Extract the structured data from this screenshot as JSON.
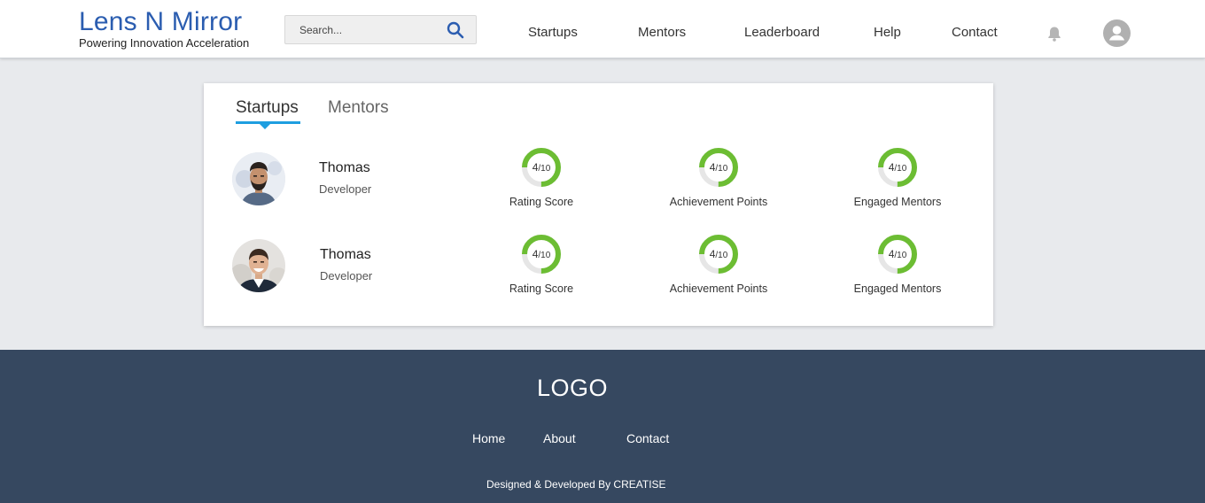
{
  "header": {
    "brand_title": "Lens N Mirror",
    "brand_subtitle": "Powering Innovation Acceleration",
    "search_placeholder": "Search...",
    "nav": [
      "Startups",
      "Mentors",
      "Leaderboard",
      "Help",
      "Contact"
    ]
  },
  "tabs": {
    "active": "Startups",
    "inactive": "Mentors"
  },
  "rows": [
    {
      "name": "Thomas",
      "role": "Developer",
      "metrics": [
        {
          "value": "4",
          "max": "/10",
          "label": "Rating Score",
          "fraction": 0.75
        },
        {
          "value": "4",
          "max": "/10",
          "label": "Achievement Points",
          "fraction": 0.75
        },
        {
          "value": "4",
          "max": "/10",
          "label": "Engaged Mentors",
          "fraction": 0.75
        }
      ]
    },
    {
      "name": "Thomas",
      "role": "Developer",
      "metrics": [
        {
          "value": "4",
          "max": "/10",
          "label": "Rating Score",
          "fraction": 0.75
        },
        {
          "value": "4",
          "max": "/10",
          "label": "Achievement Points",
          "fraction": 0.75
        },
        {
          "value": "4",
          "max": "/10",
          "label": "Engaged Mentors",
          "fraction": 0.75
        }
      ]
    }
  ],
  "footer": {
    "logo": "LOGO",
    "links": [
      "Home",
      "About",
      "Contact"
    ],
    "credit": "Designed & Developed By CREATISE"
  },
  "colors": {
    "brand": "#2b5db0",
    "accent_tab": "#1e9ee0",
    "donut_fill": "#6cbd33",
    "donut_track": "#e6e6e6",
    "footer_bg": "#364860"
  },
  "icons": {
    "search": "search-icon",
    "bell": "bell-icon",
    "user": "user-icon"
  }
}
